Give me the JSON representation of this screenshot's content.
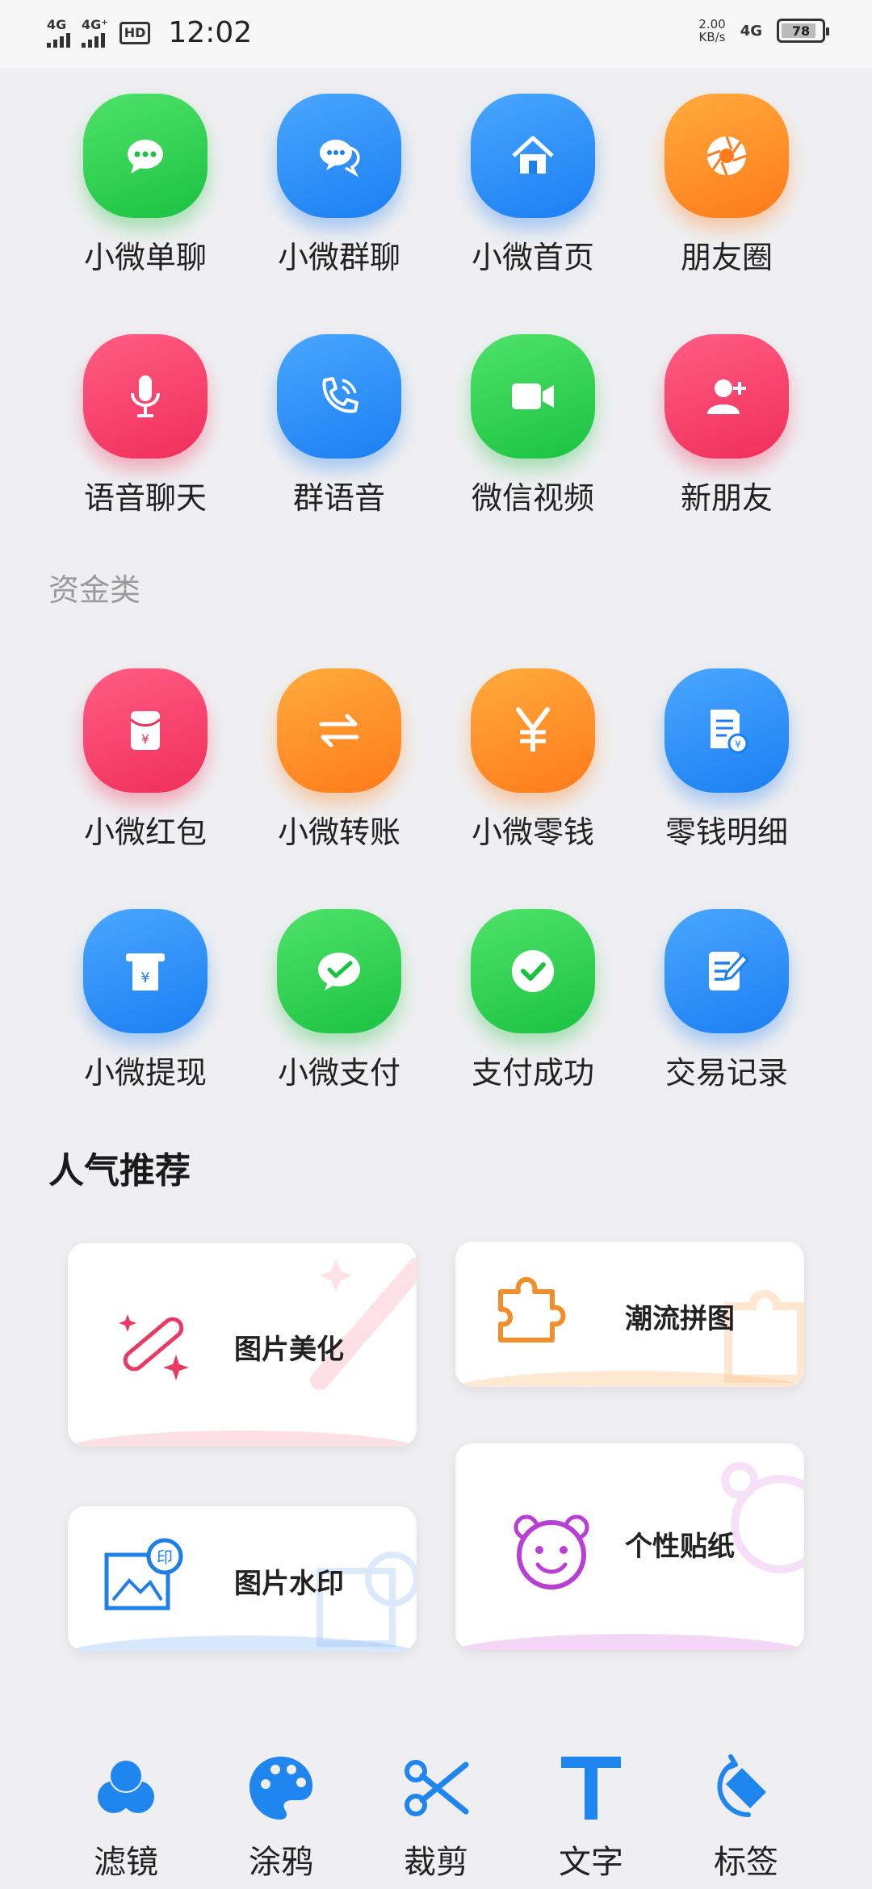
{
  "status_bar": {
    "sim1": "4G",
    "sim2": "4G⁺",
    "hd": "HD",
    "time": "12:02",
    "speed_value": "2.00",
    "speed_unit": "KB/s",
    "network": "4G",
    "battery": "78"
  },
  "chat_grid": [
    {
      "label": "小微单聊",
      "color": "green",
      "icon": "chat-bubble-icon"
    },
    {
      "label": "小微群聊",
      "color": "blue",
      "icon": "group-chat-icon"
    },
    {
      "label": "小微首页",
      "color": "blue",
      "icon": "home-icon"
    },
    {
      "label": "朋友圈",
      "color": "orange",
      "icon": "moments-shutter-icon"
    },
    {
      "label": "语音聊天",
      "color": "pink",
      "icon": "microphone-icon"
    },
    {
      "label": "群语音",
      "color": "blue",
      "icon": "phone-call-icon"
    },
    {
      "label": "微信视频",
      "color": "green",
      "icon": "video-camera-icon"
    },
    {
      "label": "新朋友",
      "color": "pink",
      "icon": "add-friend-icon"
    }
  ],
  "funds_section": {
    "label": "资金类",
    "items": [
      {
        "label": "小微红包",
        "color": "pink",
        "icon": "red-packet-icon"
      },
      {
        "label": "小微转账",
        "color": "orange",
        "icon": "transfer-arrows-icon"
      },
      {
        "label": "小微零钱",
        "color": "orange",
        "icon": "yuan-icon"
      },
      {
        "label": "零钱明细",
        "color": "blue",
        "icon": "bill-detail-icon"
      },
      {
        "label": "小微提现",
        "color": "blue",
        "icon": "withdraw-icon"
      },
      {
        "label": "小微支付",
        "color": "green",
        "icon": "wechat-pay-icon"
      },
      {
        "label": "支付成功",
        "color": "green",
        "icon": "check-circle-icon"
      },
      {
        "label": "交易记录",
        "color": "blue",
        "icon": "record-edit-icon"
      }
    ]
  },
  "popular": {
    "title": "人气推荐",
    "cards": [
      {
        "title": "图片美化",
        "icon": "magic-wand-icon"
      },
      {
        "title": "潮流拼图",
        "icon": "puzzle-icon"
      },
      {
        "title": "图片水印",
        "icon": "watermark-icon"
      },
      {
        "title": "个性贴纸",
        "icon": "bear-sticker-icon"
      }
    ]
  },
  "toolbar": [
    {
      "label": "滤镜",
      "icon": "filter-circles-icon"
    },
    {
      "label": "涂鸦",
      "icon": "palette-icon"
    },
    {
      "label": "裁剪",
      "icon": "scissors-icon"
    },
    {
      "label": "文字",
      "icon": "text-t-icon"
    },
    {
      "label": "标签",
      "icon": "tag-rotate-icon"
    }
  ],
  "colors": {
    "green": "#22c447",
    "blue": "#1f82f4",
    "orange": "#ff8a22",
    "pink": "#f23a64",
    "background": "#efeff1"
  }
}
